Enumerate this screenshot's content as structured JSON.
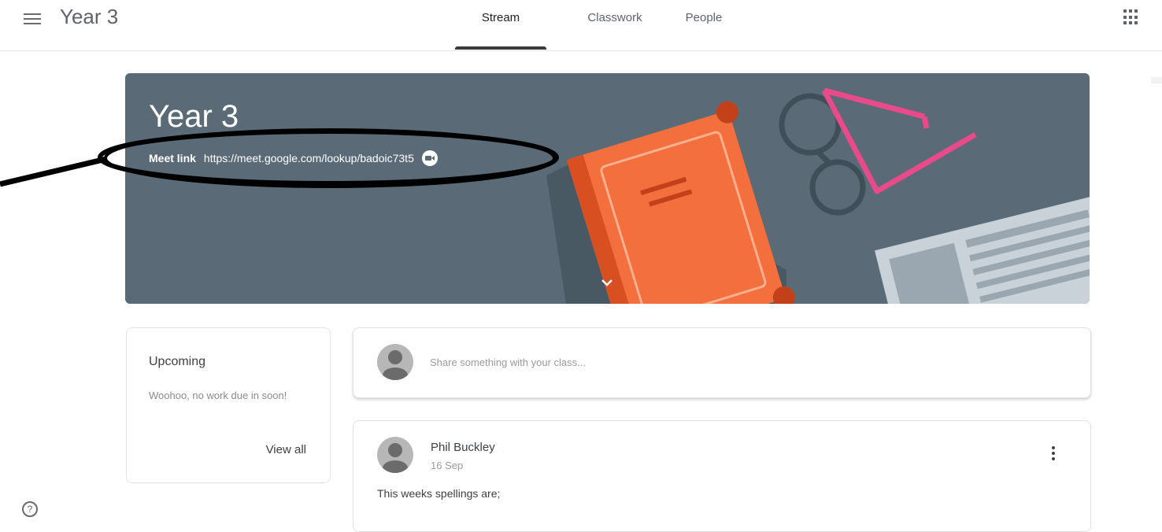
{
  "header": {
    "course_title": "Year 3",
    "tabs": [
      {
        "label": "Stream",
        "active": true
      },
      {
        "label": "Classwork",
        "active": false
      },
      {
        "label": "People",
        "active": false
      }
    ]
  },
  "banner": {
    "title": "Year 3",
    "meet_label": "Meet link",
    "meet_url": "https://meet.google.com/lookup/badoic73t5"
  },
  "upcoming": {
    "title": "Upcoming",
    "message": "Woohoo, no work due in soon!",
    "view_all": "View all"
  },
  "share": {
    "placeholder": "Share something with your class..."
  },
  "post": {
    "author": "Phil Buckley",
    "date": "16 Sep",
    "body": "This weeks spellings are;"
  },
  "help": {
    "glyph": "?"
  },
  "colors": {
    "banner": "#5a6b77",
    "book": "#f36f3d",
    "glasses_pink": "#e84a8a"
  }
}
